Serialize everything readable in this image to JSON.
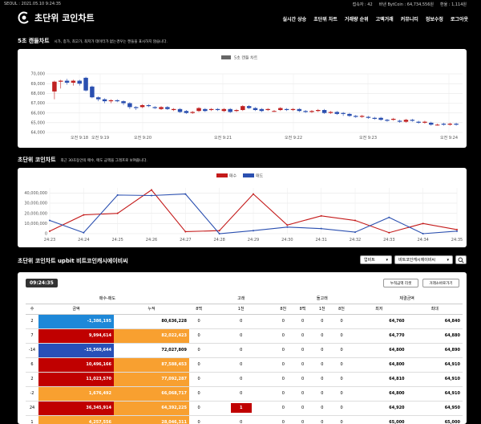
{
  "topbar": {
    "location_time": "SEOUL : 2021.05.10 9:24:35",
    "visitors": "접속자 : 42",
    "bitcoin": "바낸 BytCoin : 64,734,556원",
    "exchange": "환율 : 1,114원"
  },
  "header": {
    "logo": "초단위 코인차트",
    "nav": [
      "실시간 상승",
      "초단위 차트",
      "거래량 순위",
      "고액거래",
      "커뮤니티",
      "정보수정",
      "로그아웃"
    ]
  },
  "candle_section": {
    "title": "5초 캔들차트",
    "subtitle": "시가, 종가, 최고가, 최저가 데이터가 없는경우는 캔들을 표시하지 않습니다."
  },
  "line_section": {
    "title": "초단위 코인차트",
    "subtitle": "최근 30초동안의 매수, 매도 금액을 그래프로 보여줍니다."
  },
  "table_section": {
    "title": "초단위 코인차트 upbit 비트코인캐시에이비씨",
    "exchange_select": "업비트",
    "coin_select": "비트코인캐시에이비씨",
    "time": "09:24:35",
    "reset_button": "누적금액 리셋",
    "sort_button": "거래소바로가기",
    "group_headers": [
      "매수-매도",
      "고래",
      "돌고래",
      "체결금액"
    ],
    "sub_headers": [
      "수",
      "금액",
      "누적",
      "8백",
      "1천",
      "8천",
      "8백",
      "1천",
      "8천",
      "최저",
      "최대"
    ],
    "rows": [
      {
        "count": "2",
        "amount": "-1,386,195",
        "acc": "80,636,228",
        "w1": "0",
        "w2": "0",
        "w3": "0",
        "d1": "0",
        "d2": "0",
        "d3": "0",
        "min": "64,760",
        "max": "64,840",
        "ac": "c-blue",
        "cc": "c-white"
      },
      {
        "count": "7",
        "amount": "9,994,614",
        "acc": "82,022,423",
        "w1": "0",
        "w2": "0",
        "w3": "0",
        "d1": "0",
        "d2": "0",
        "d3": "0",
        "min": "64,770",
        "max": "64,880",
        "ac": "c-red",
        "cc": "c-orange"
      },
      {
        "count": "-14",
        "amount": "-15,560,644",
        "acc": "72,027,809",
        "w1": "0",
        "w2": "0",
        "w3": "0",
        "d1": "0",
        "d2": "0",
        "d3": "0",
        "min": "64,800",
        "max": "64,890",
        "ac": "c-navy",
        "cc": "c-white"
      },
      {
        "count": "6",
        "amount": "10,496,166",
        "acc": "87,588,453",
        "w1": "0",
        "w2": "0",
        "w3": "0",
        "d1": "0",
        "d2": "0",
        "d3": "0",
        "min": "64,800",
        "max": "64,910",
        "ac": "c-red",
        "cc": "c-orange"
      },
      {
        "count": "2",
        "amount": "11,023,570",
        "acc": "77,092,287",
        "w1": "0",
        "w2": "0",
        "w3": "0",
        "d1": "0",
        "d2": "0",
        "d3": "0",
        "min": "64,810",
        "max": "64,910",
        "ac": "c-red",
        "cc": "c-orange"
      },
      {
        "count": "-2",
        "amount": "1,676,492",
        "acc": "66,068,717",
        "w1": "0",
        "w2": "0",
        "w3": "0",
        "d1": "0",
        "d2": "0",
        "d3": "0",
        "min": "64,800",
        "max": "64,910",
        "ac": "c-orange",
        "cc": "c-orange"
      },
      {
        "count": "24",
        "amount": "36,345,914",
        "acc": "64,392,225",
        "w1": "0",
        "w2": "1",
        "w3": "0",
        "d1": "0",
        "d2": "0",
        "d3": "0",
        "min": "64,920",
        "max": "64,950",
        "ac": "c-red",
        "cc": "c-orange"
      },
      {
        "count": "1",
        "amount": "4,257,556",
        "acc": "28,046,311",
        "w1": "0",
        "w2": "0",
        "w3": "0",
        "d1": "0",
        "d2": "0",
        "d3": "0",
        "min": "65,000",
        "max": "65,000",
        "ac": "c-orange",
        "cc": "c-orange"
      }
    ]
  },
  "chart_data": [
    {
      "type": "bar",
      "title": "",
      "legend": "5초 캔들 차트",
      "ylim": [
        64000,
        70000
      ],
      "y_ticks": [
        "70,000",
        "69,000",
        "68,000",
        "67,000",
        "66,000",
        "65,000",
        "64,000"
      ],
      "x_ticks": [
        "오전 9:18",
        "오전 9:19",
        "오전 9:20",
        "오전 9:21",
        "오전 9:22",
        "오전 9:23",
        "오전 9:24"
      ],
      "colors": {
        "up": "#c02020",
        "down": "#2a4fb0"
      },
      "candles": [
        [
          68200,
          69200,
          69300,
          67400
        ],
        [
          69200,
          69300,
          69400,
          68500
        ],
        [
          69300,
          69100,
          69500,
          68900
        ],
        [
          69100,
          69300,
          69400,
          68800
        ],
        [
          69300,
          69000,
          69400,
          68800
        ],
        [
          69600,
          68300,
          69700,
          68200
        ],
        [
          68700,
          67600,
          68800,
          67500
        ],
        [
          67600,
          67400,
          67700,
          67200
        ],
        [
          67400,
          67200,
          67500,
          67000
        ],
        [
          67200,
          67300,
          67400,
          67000
        ],
        [
          67300,
          67200,
          67400,
          67100
        ],
        [
          67200,
          67000,
          67300,
          66800
        ],
        [
          67000,
          66600,
          67100,
          66400
        ],
        [
          66600,
          66500,
          66700,
          66300
        ],
        [
          66600,
          66800,
          66900,
          66500
        ],
        [
          66800,
          66700,
          66900,
          66600
        ],
        [
          66600,
          66500,
          66700,
          66400
        ],
        [
          66400,
          66600,
          66700,
          66300
        ],
        [
          66600,
          66400,
          66700,
          66300
        ],
        [
          66300,
          66400,
          66500,
          66200
        ],
        [
          66400,
          66100,
          66500,
          66000
        ],
        [
          66200,
          66000,
          66300,
          65900
        ],
        [
          66000,
          66100,
          66200,
          65900
        ],
        [
          66200,
          66500,
          66600,
          66100
        ],
        [
          66400,
          66200,
          66500,
          66100
        ],
        [
          66300,
          66400,
          66500,
          66200
        ],
        [
          66400,
          66300,
          66500,
          66200
        ],
        [
          66200,
          66400,
          66500,
          66100
        ],
        [
          66400,
          66100,
          66500,
          66000
        ],
        [
          66200,
          66300,
          66400,
          66100
        ],
        [
          66300,
          66700,
          66800,
          66200
        ],
        [
          66700,
          66500,
          66800,
          66400
        ],
        [
          66500,
          66300,
          66600,
          66200
        ],
        [
          66400,
          66200,
          66500,
          66100
        ],
        [
          66300,
          66400,
          66500,
          66200
        ],
        [
          66200,
          66200,
          66300,
          66100
        ],
        [
          66300,
          66500,
          66600,
          66200
        ],
        [
          66400,
          66300,
          66500,
          66200
        ],
        [
          66300,
          66400,
          66500,
          66200
        ],
        [
          66400,
          66200,
          66500,
          66100
        ],
        [
          66200,
          66100,
          66300,
          66000
        ],
        [
          66100,
          66200,
          66300,
          66000
        ],
        [
          66200,
          66300,
          66400,
          66100
        ],
        [
          66300,
          66000,
          66400,
          65900
        ],
        [
          66000,
          66100,
          66200,
          65900
        ],
        [
          66100,
          65900,
          66200,
          65800
        ],
        [
          66000,
          65900,
          66100,
          65700
        ],
        [
          65900,
          65700,
          66000,
          65600
        ],
        [
          65700,
          65600,
          65800,
          65500
        ],
        [
          65600,
          65700,
          65800,
          65500
        ],
        [
          65600,
          65500,
          65700,
          65400
        ],
        [
          65500,
          65400,
          65600,
          65300
        ],
        [
          65500,
          65300,
          65600,
          65200
        ],
        [
          65300,
          65200,
          65400,
          65100
        ],
        [
          65300,
          65400,
          65500,
          65200
        ],
        [
          65200,
          65100,
          65300,
          65000
        ],
        [
          65100,
          65300,
          65400,
          65000
        ],
        [
          65300,
          65200,
          65400,
          65100
        ],
        [
          65100,
          65000,
          65200,
          64900
        ],
        [
          65000,
          65100,
          65200,
          64900
        ],
        [
          65000,
          64800,
          65100,
          64700
        ],
        [
          64800,
          64800,
          64900,
          64700
        ],
        [
          64900,
          64800,
          65000,
          64700
        ],
        [
          64800,
          64900,
          65000,
          64700
        ],
        [
          64900,
          64800,
          65000,
          64700
        ]
      ]
    },
    {
      "type": "line",
      "title": "",
      "categories": [
        "24:23",
        "24:24",
        "24:25",
        "24:26",
        "24:27",
        "24:28",
        "24:29",
        "24:30",
        "24:31",
        "24:32",
        "24:33",
        "24:34",
        "24:35"
      ],
      "ylim": [
        0,
        45000000
      ],
      "y_ticks": [
        "40,000,000",
        "30,000,000",
        "20,000,000",
        "10,000,000",
        "0"
      ],
      "series": [
        {
          "name": "매수",
          "color": "#c41a1a",
          "values": [
            2500000,
            18500000,
            20000000,
            43000000,
            2000000,
            3000000,
            39000000,
            8500000,
            17500000,
            13000000,
            1000000,
            10000000,
            4000000
          ]
        },
        {
          "name": "매도",
          "color": "#2a4fb0",
          "values": [
            13000000,
            1000000,
            38000000,
            37500000,
            39000000,
            0,
            3000000,
            6500000,
            5000000,
            1500000,
            16000000,
            0,
            2500000
          ]
        }
      ]
    }
  ]
}
